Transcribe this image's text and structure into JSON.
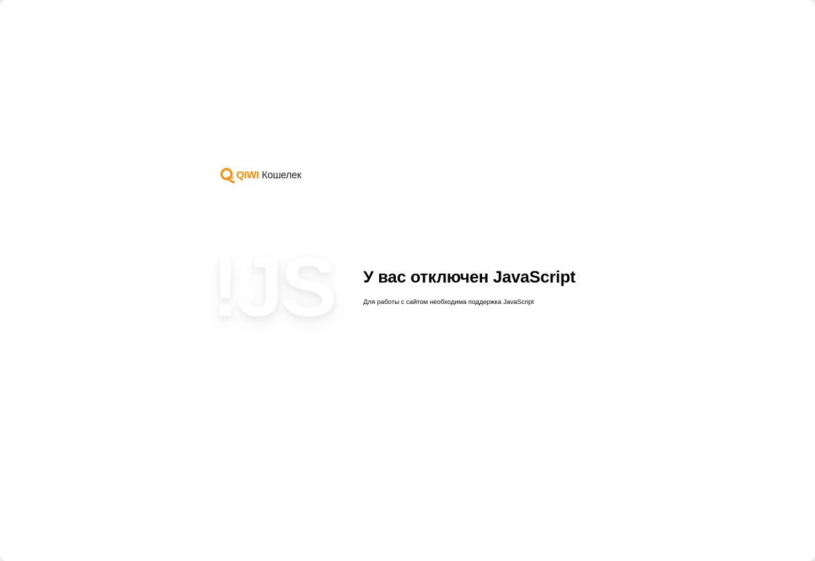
{
  "logo": {
    "brand": "QIWI",
    "product": "Кошелек",
    "accent_color": "#ff8c00"
  },
  "hero": {
    "art_text": "!JS"
  },
  "message": {
    "title": "У вас отключен JavaScript",
    "subtitle": "Для работы с сайтом необходима поддержка JavaScript"
  }
}
